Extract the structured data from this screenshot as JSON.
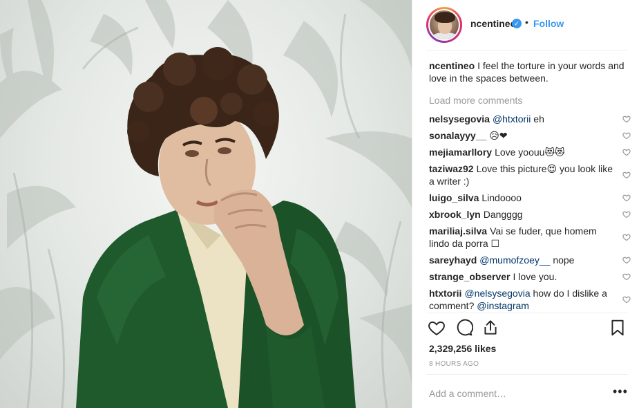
{
  "post": {
    "username": "ncentineo",
    "verified_icon": "verified-badge-icon",
    "separator": "•",
    "follow_label": "Follow"
  },
  "caption": {
    "user": "ncentineo",
    "text": "I feel the torture in your words and love in the spaces between."
  },
  "load_more_label": "Load more comments",
  "comments": [
    {
      "user": "nelsysegovia",
      "mention": "@htxtorii",
      "text": " eh"
    },
    {
      "user": "sonalayyy__",
      "mention": "",
      "text": "😥❤"
    },
    {
      "user": "mejiamarllory",
      "mention": "",
      "text": "Love yoouu😻😻"
    },
    {
      "user": "taziwaz92",
      "mention": "",
      "text": "Love this picture😍 you look like a writer :)"
    },
    {
      "user": "luigo_silva",
      "mention": "",
      "text": "Lindoooo"
    },
    {
      "user": "xbrook_lyn",
      "mention": "",
      "text": "Dangggg"
    },
    {
      "user": "mariliaj.silva",
      "mention": "",
      "text": "Vai se fuder, que homem lindo da porra ☐"
    },
    {
      "user": "sareyhayd",
      "mention": "@mumofzoey__",
      "text": " nope"
    },
    {
      "user": "strange_observer",
      "mention": "",
      "text": "I love you."
    },
    {
      "user": "htxtorii",
      "mention": "@nelsysegovia",
      "text": " how do I dislike a comment? ",
      "mention2": "@instagram"
    }
  ],
  "actions": {
    "like_icon": "heart-outline-icon",
    "comment_icon": "comment-bubble-icon",
    "share_icon": "share-upload-icon",
    "save_icon": "bookmark-icon"
  },
  "likes_text": "2,329,256 likes",
  "time_ago": "8 HOURS AGO",
  "add_comment_placeholder": "Add a comment…",
  "more_label": "•••",
  "colors": {
    "link_blue": "#3897f0",
    "mention_blue": "#003569",
    "muted_gray": "#999999",
    "jacket_green": "#1f5a2c"
  }
}
